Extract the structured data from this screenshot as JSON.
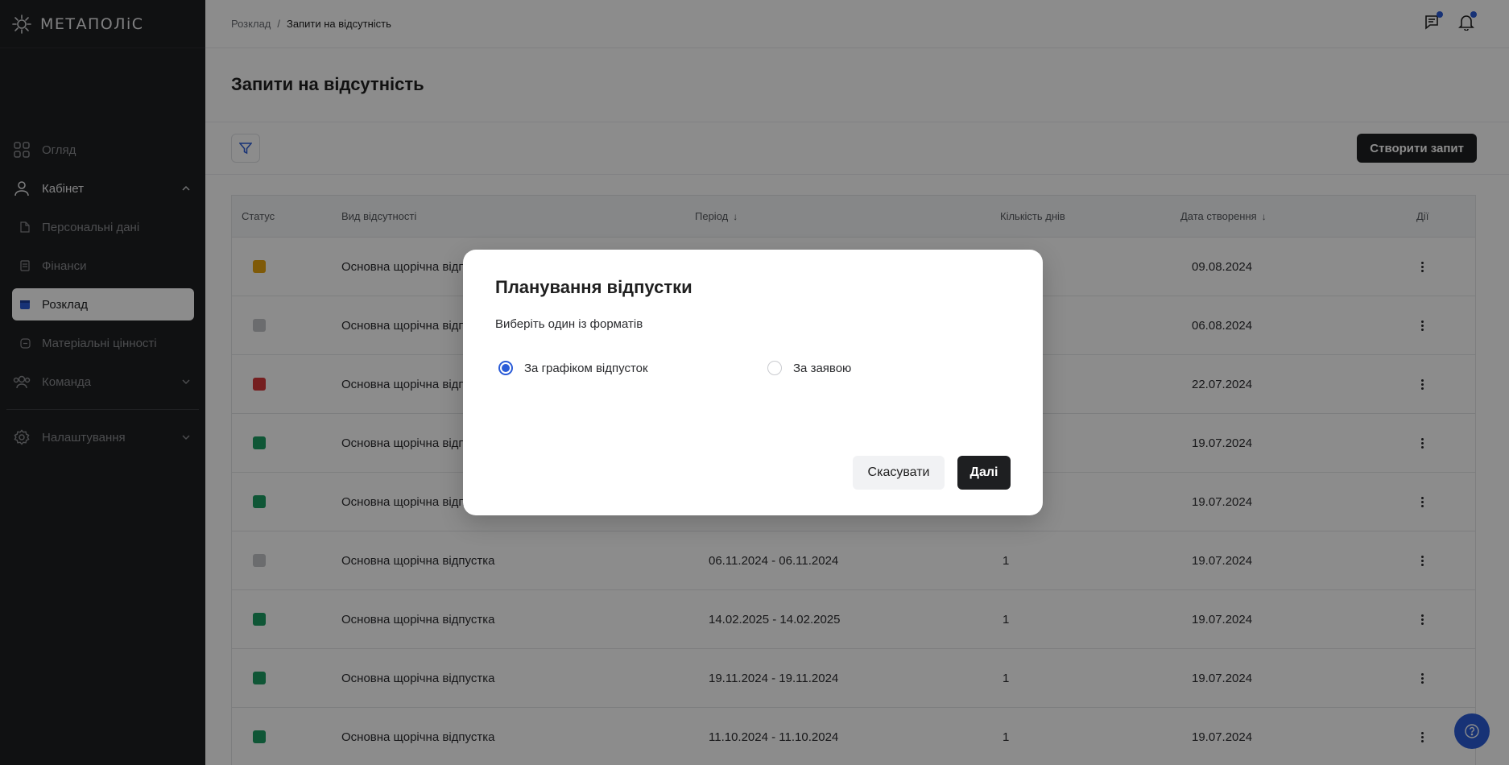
{
  "app": {
    "logo_text": "МЕТАПОЛіС"
  },
  "sidebar": {
    "items": [
      {
        "label": "Огляд",
        "icon": "grid-icon"
      },
      {
        "label": "Кабінет",
        "icon": "user-icon",
        "expanded": true
      },
      {
        "label": "Персональні дані",
        "icon": "file-icon"
      },
      {
        "label": "Фінанси",
        "icon": "document-icon"
      },
      {
        "label": "Розклад",
        "icon": "calendar-icon",
        "active": true
      },
      {
        "label": "Матеріальні цінності",
        "icon": "box-icon"
      },
      {
        "label": "Команда",
        "icon": "team-icon"
      },
      {
        "label": "Налаштування",
        "icon": "gear-icon"
      }
    ]
  },
  "breadcrumb": {
    "parent": "Розклад",
    "separator": "/",
    "current": "Запити на відсутність"
  },
  "page": {
    "title": "Запити на відсутність",
    "create_label": "Створити запит"
  },
  "table": {
    "headers": {
      "status": "Статус",
      "type": "Вид відсутності",
      "period": "Період",
      "days": "Кількість днів",
      "created": "Дата створення",
      "actions": "Дії"
    },
    "rows": [
      {
        "status_color": "#e8a50f",
        "type": "Основна щорічна відпустка",
        "period": "",
        "days": "",
        "created": "09.08.2024"
      },
      {
        "status_color": "#c4c5c8",
        "type": "Основна щорічна відпустка",
        "period": "",
        "days": "",
        "created": "06.08.2024"
      },
      {
        "status_color": "#d6393b",
        "type": "Основна щорічна відпустка",
        "period": "",
        "days": "",
        "created": "22.07.2024"
      },
      {
        "status_color": "#1d9d63",
        "type": "Основна щорічна відпустка",
        "period": "",
        "days": "",
        "created": "19.07.2024"
      },
      {
        "status_color": "#1d9d63",
        "type": "Основна щорічна відпустка",
        "period": "",
        "days": "",
        "created": "19.07.2024"
      },
      {
        "status_color": "#c4c5c8",
        "type": "Основна щорічна відпустка",
        "period": "06.11.2024 - 06.11.2024",
        "days": "1",
        "created": "19.07.2024"
      },
      {
        "status_color": "#1d9d63",
        "type": "Основна щорічна відпустка",
        "period": "14.02.2025 - 14.02.2025",
        "days": "1",
        "created": "19.07.2024"
      },
      {
        "status_color": "#1d9d63",
        "type": "Основна щорічна відпустка",
        "period": "19.11.2024 - 19.11.2024",
        "days": "1",
        "created": "19.07.2024"
      },
      {
        "status_color": "#1d9d63",
        "type": "Основна щорічна відпустка",
        "period": "11.10.2024 - 11.10.2024",
        "days": "1",
        "created": "19.07.2024"
      }
    ]
  },
  "modal": {
    "title": "Планування відпустки",
    "subtitle": "Виберіть один із форматів",
    "options": [
      {
        "label": "За графіком відпусток",
        "selected": true
      },
      {
        "label": "За заявою",
        "selected": false
      }
    ],
    "cancel_label": "Скасувати",
    "next_label": "Далі"
  },
  "colors": {
    "accent": "#2a5bd7",
    "sidebar_bg": "#1e1f21",
    "primary_button": "#1e1f21"
  }
}
